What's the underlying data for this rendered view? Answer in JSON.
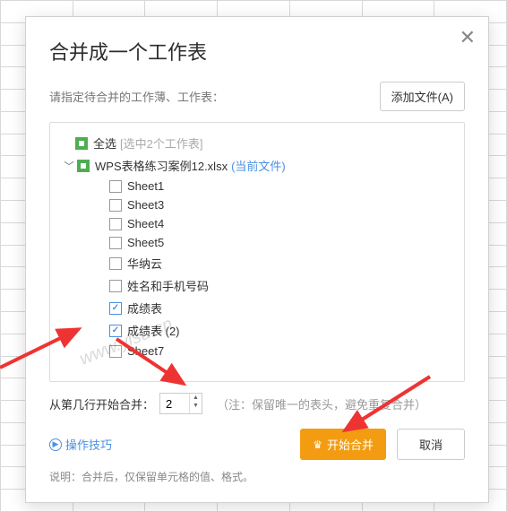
{
  "dialog": {
    "title": "合并成一个工作表",
    "prompt": "请指定待合并的工作薄、工作表：",
    "add_file": "添加文件(A)",
    "select_all": "全选",
    "select_all_hint": "[选中2个工作表]",
    "file_node": "WPS表格练习案例12.xlsx",
    "current_file_tag": "(当前文件)",
    "sheets": [
      {
        "label": "Sheet1",
        "checked": false
      },
      {
        "label": "Sheet3",
        "checked": false
      },
      {
        "label": "Sheet4",
        "checked": false
      },
      {
        "label": "Sheet5",
        "checked": false
      },
      {
        "label": "华纳云",
        "checked": false
      },
      {
        "label": "姓名和手机号码",
        "checked": false
      },
      {
        "label": "成绩表",
        "checked": true
      },
      {
        "label": "成绩表 (2)",
        "checked": true
      },
      {
        "label": "Sheet7",
        "checked": false
      }
    ],
    "start_row_label": "从第几行开始合并：",
    "start_row_value": "2",
    "start_row_note": "（注：保留唯一的表头，避免重复合并）",
    "tips": "操作技巧",
    "primary": "开始合并",
    "cancel": "取消",
    "footer": "说明：合并后，仅保留单元格的值、格式。"
  },
  "watermark": "www.yisu.cn"
}
